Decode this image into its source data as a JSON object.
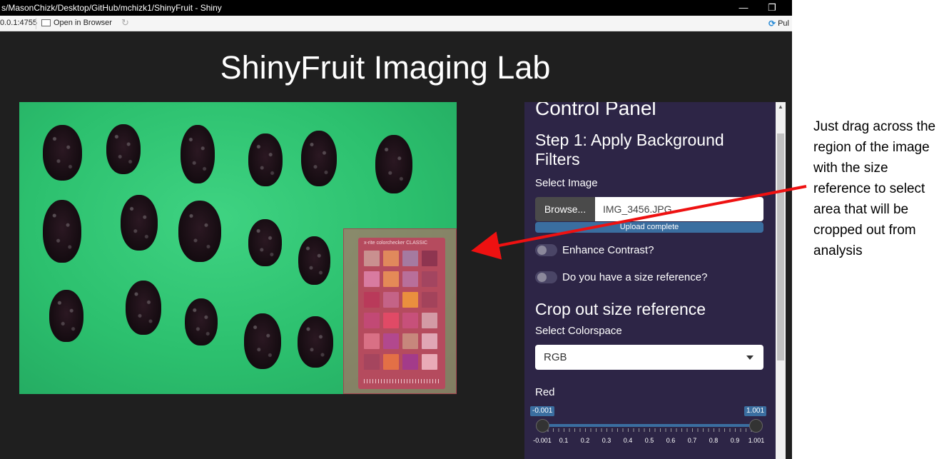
{
  "window": {
    "title": "s/MasonChizk/Desktop/GitHub/mchizk1/ShinyFruit - Shiny",
    "address": "0.0.1:4755",
    "open_in_browser": "Open in Browser",
    "publish": "Pul",
    "minimize_glyph": "—",
    "restore_glyph": "❐"
  },
  "app": {
    "title": "ShinyFruit Imaging Lab",
    "checker_brand": "x-rite   colorchecker CLASSIC"
  },
  "panel": {
    "heading": "Control Panel",
    "step1": "Step 1: Apply Background Filters",
    "select_image_label": "Select Image",
    "browse_label": "Browse...",
    "file_name": "IMG_3456.JPG",
    "upload_status": "Upload complete",
    "toggle_contrast": "Enhance Contrast?",
    "toggle_size_ref": "Do you have a size reference?",
    "crop_heading": "Crop out size reference",
    "colorspace_label": "Select Colorspace",
    "colorspace_value": "RGB",
    "red_label": "Red",
    "red_slider": {
      "min_value": "-0.001",
      "max_value": "1.001",
      "ticks": [
        "-0.001",
        "0.1",
        "0.2",
        "0.3",
        "0.4",
        "0.5",
        "0.6",
        "0.7",
        "0.8",
        "0.9",
        "1.001"
      ]
    }
  },
  "annotation": {
    "text": "Just drag across the region of the image with the size reference to select area that will be cropped out from analysis",
    "arrow_color": "#ee1111"
  },
  "colors": {
    "app_background": "#1f1f1f",
    "panel_background": "#2d2546",
    "accent_blue": "#3a6ea0",
    "backdrop_green": "#2cc06e"
  }
}
